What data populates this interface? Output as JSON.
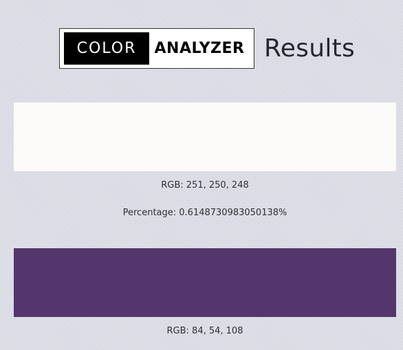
{
  "header": {
    "logo_left": "COLOR",
    "logo_right": "ANALYZER",
    "title": "Results"
  },
  "colors": [
    {
      "hex": "#fbfaf8",
      "rgb_text": "RGB: 251, 250, 248",
      "percentage_text": "Percentage: 0.6148730983050138%"
    },
    {
      "hex": "#54366c",
      "rgb_text": "RGB: 84, 54, 108"
    }
  ],
  "theme": {
    "background": "#dcdde6"
  }
}
